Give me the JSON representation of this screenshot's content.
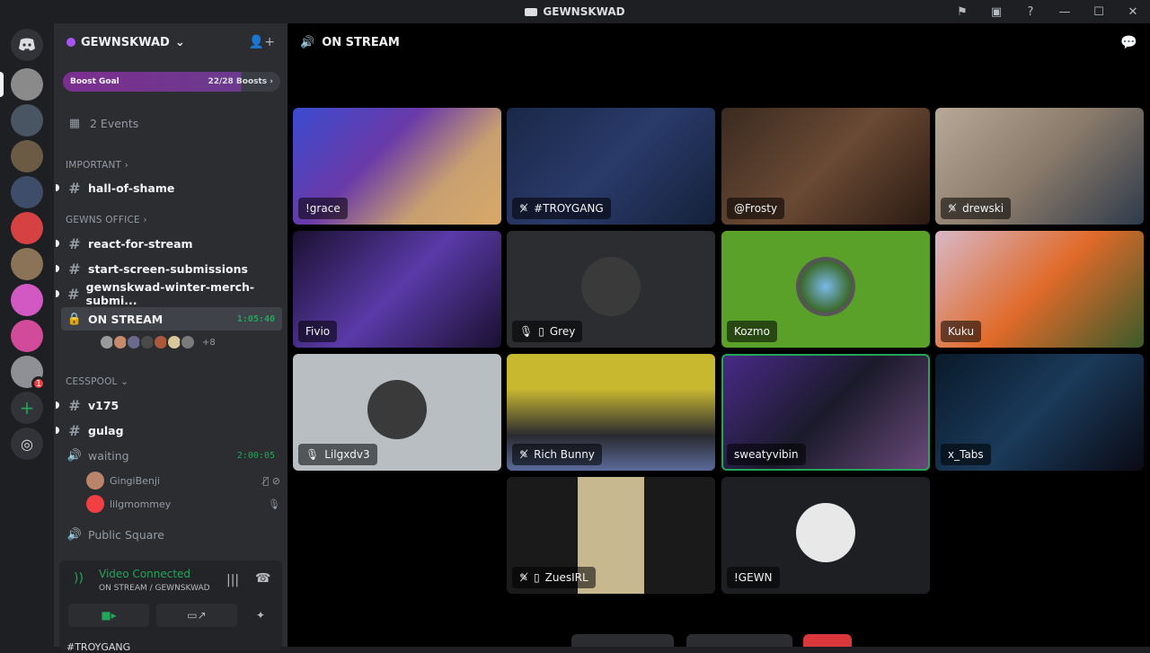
{
  "window": {
    "title": "GEWNSKWAD"
  },
  "servers": {
    "items": [
      {
        "name": "discord-home",
        "color": "#5865f2"
      },
      {
        "name": "gewnskwad",
        "color": "#8a8a8a"
      },
      {
        "name": "car-server-1",
        "color": "#4a5563"
      },
      {
        "name": "car-server-2",
        "color": "#6b5b45"
      },
      {
        "name": "car-server-3",
        "color": "#3e4e6a"
      },
      {
        "name": "mushroom-server",
        "color": "#d64141"
      },
      {
        "name": "character-server",
        "color": "#8a7356"
      },
      {
        "name": "pink-server",
        "color": "#d259c4"
      },
      {
        "name": "andii-skwad",
        "color": "#d24a9a"
      },
      {
        "name": "pinwheel-server",
        "color": "#8e9096"
      }
    ],
    "badge": "1"
  },
  "guild": {
    "name": "GEWNSKWAD",
    "boost_label": "Boost Goal",
    "boost_progress": "22/28 Boosts",
    "boost_fraction": 0.786,
    "events": "2 Events"
  },
  "categories": {
    "important": "IMPORTANT",
    "gewns_office": "GEWNS OFFICE",
    "cesspool": "CESSPOOL"
  },
  "channels": {
    "hall_of_shame": "hall-of-shame",
    "react_for_stream": "react-for-stream",
    "start_screen": "start-screen-submissions",
    "merch": "gewnskwad-winter-merch-submi...",
    "on_stream": "ON STREAM",
    "on_stream_time": "1:05:40",
    "on_stream_more": "+8",
    "v175": "v175",
    "gulag": "gulag",
    "waiting": "waiting",
    "waiting_time": "2:00:05",
    "public_square": "Public Square"
  },
  "waiting_users": [
    {
      "name": "GingiBenji",
      "icons": "mic-off-icon deafen-icon"
    },
    {
      "name": "lilgmommey",
      "icons": "mic-icon"
    }
  ],
  "voice_panel": {
    "status": "Video Connected",
    "sub": "ON STREAM / GEWNSKWAD"
  },
  "bottom_user": "#TROYGANG",
  "main": {
    "title": "ON STREAM"
  },
  "tiles": [
    {
      "label": "!grace",
      "icons": "",
      "bg": "linear-gradient(135deg,#3b4bd0 0%,#6a3aa8 40%,#c8a070 70%,#d8a868 100%)"
    },
    {
      "label": "#TROYGANG",
      "icons": "mute",
      "bg": "linear-gradient(135deg,#1a2848 0%,#2a3a6a 50%,#14213a 100%)"
    },
    {
      "label": "@Frosty",
      "icons": "",
      "bg": "linear-gradient(135deg,#3a2a20 0%,#6a4a34 50%,#2a1a12 100%)"
    },
    {
      "label": "drewski",
      "icons": "mute",
      "bg": "linear-gradient(135deg,#b8a898 0%,#8a7a6a 50%,#2e3a4a 100%)"
    },
    {
      "label": "Fivio",
      "icons": "",
      "bg": "linear-gradient(135deg,#1a1030 0%,#5a3aa8 50%,#1a1030 100%)"
    },
    {
      "label": "Grey",
      "icons": "mic phone",
      "bg": "#2b2d31"
    },
    {
      "label": "Kozmo",
      "icons": "",
      "bg": "#5aa12a"
    },
    {
      "label": "Kuku",
      "icons": "",
      "bg": "linear-gradient(135deg,#d8b8c8 0%,#e06a2a 50%,#3a5a2a 100%)"
    },
    {
      "label": "Lilgxdv3",
      "icons": "mic",
      "bg": "#b9bec3"
    },
    {
      "label": "Rich Bunny",
      "icons": "mute",
      "bg": "linear-gradient(180deg,#c8b830 0%,#c8b830 30%,#2a2a30 70%,#5a6a9a 100%)"
    },
    {
      "label": "sweatyvibin",
      "icons": "",
      "bg": "linear-gradient(135deg,#4a2a8a 0%,#1a1a2a 50%,#6a4a7a 100%)"
    },
    {
      "label": "x_Tabs",
      "icons": "",
      "bg": "linear-gradient(135deg,#0a1a2a 0%,#1a3a5a 50%,#0a0a14 100%)"
    },
    {
      "label": "ZuesIRL",
      "icons": "mute phone",
      "bg": "linear-gradient(90deg,#1a1a1a 0%,#1a1a1a 34%,#c8b890 34%,#c8b890 66%,#1a1a1a 66%)"
    },
    {
      "label": "!GEWN",
      "icons": "",
      "bg": "#1e1f22"
    }
  ]
}
